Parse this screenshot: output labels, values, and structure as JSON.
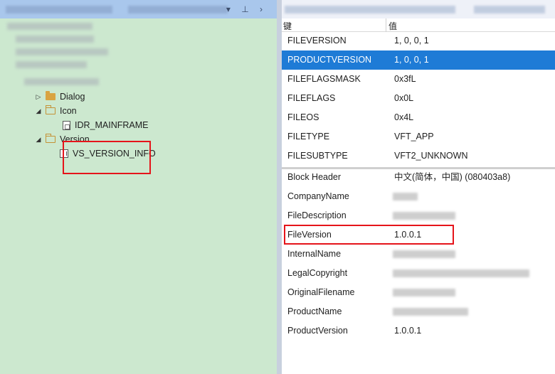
{
  "left_panel": {
    "title_icons": "▾ ⊥ ›",
    "tree": [
      {
        "id": "dialog",
        "label": "Dialog",
        "expanded": false
      },
      {
        "id": "icon",
        "label": "Icon",
        "expanded": true
      },
      {
        "id": "idr",
        "label": "IDR_MAINFRAME"
      },
      {
        "id": "version",
        "label": "Version",
        "expanded": true
      },
      {
        "id": "vsinfo",
        "label": "VS_VERSION_INFO"
      }
    ]
  },
  "right_panel": {
    "header": {
      "key": "键",
      "value": "值"
    },
    "fixed_rows": [
      {
        "key": "FILEVERSION",
        "value": "1, 0, 0, 1"
      },
      {
        "key": "PRODUCTVERSION",
        "value": "1, 0, 0, 1",
        "selected": true
      },
      {
        "key": "FILEFLAGSMASK",
        "value": "0x3fL"
      },
      {
        "key": "FILEFLAGS",
        "value": "0x0L"
      },
      {
        "key": "FILEOS",
        "value": "0x4L"
      },
      {
        "key": "FILETYPE",
        "value": "VFT_APP"
      },
      {
        "key": "FILESUBTYPE",
        "value": "VFT2_UNKNOWN"
      }
    ],
    "block_rows": [
      {
        "key": "Block Header",
        "value": "中文(简体，中国) (080403a8)"
      },
      {
        "key": "CompanyName",
        "value": ""
      },
      {
        "key": "FileDescription",
        "value": ""
      },
      {
        "key": "FileVersion",
        "value": "1.0.0.1"
      },
      {
        "key": "InternalName",
        "value": ""
      },
      {
        "key": "LegalCopyright",
        "value": ""
      },
      {
        "key": "OriginalFilename",
        "value": ""
      },
      {
        "key": "ProductName",
        "value": ""
      },
      {
        "key": "ProductVersion",
        "value": "1.0.0.1"
      }
    ]
  },
  "colors": {
    "left_background": "#cce8cf",
    "selection": "#1e7bd6",
    "highlight_box": "#e5141a"
  }
}
